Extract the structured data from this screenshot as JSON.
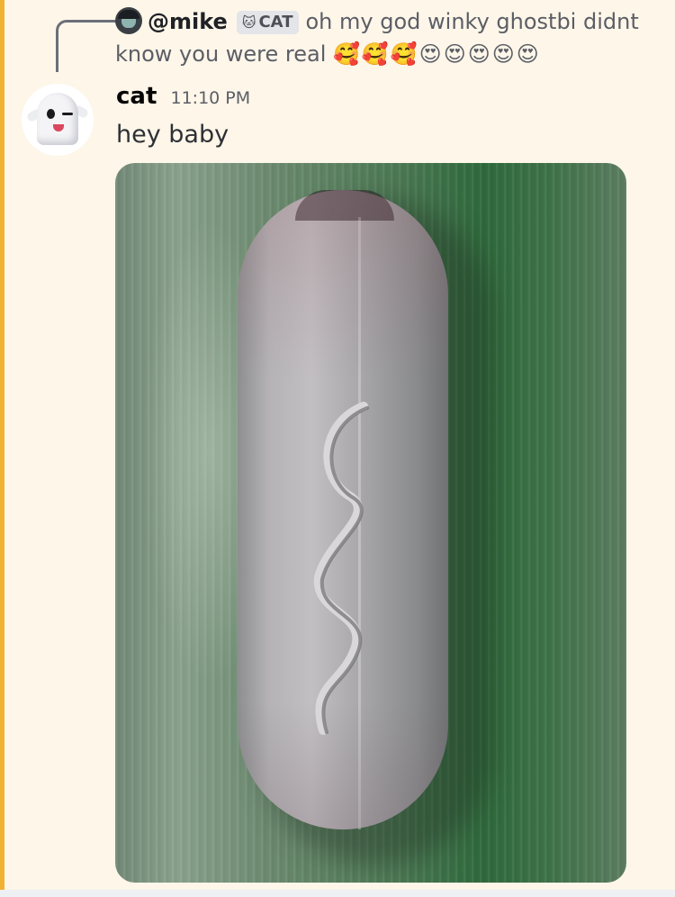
{
  "reply": {
    "username": "@mike",
    "tag_icon": "cat-icon",
    "tag_glyph": "🐱",
    "tag_label": "CAT",
    "text": "oh my god winky ghostbi didnt know you were real",
    "emojis": "🥰🥰🥰😍😍😍😍😍"
  },
  "message": {
    "author": "cat",
    "timestamp": "11:10 PM",
    "content": "hey baby",
    "avatar_icon": "winking-ghost-icon"
  },
  "colors": {
    "mention_highlight": "#fdf6e9",
    "mention_bar": "#f0b232"
  }
}
